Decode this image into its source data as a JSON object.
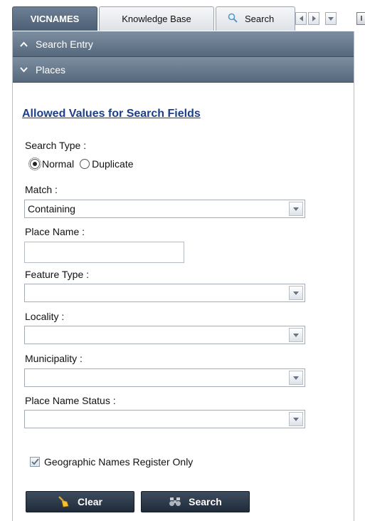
{
  "tabs": {
    "active": "VICNAMES",
    "knowledge_base": "Knowledge Base",
    "search": "Search",
    "pin": "I"
  },
  "accordion": {
    "search_entry": "Search Entry",
    "places": "Places"
  },
  "form": {
    "title": "Allowed Values for Search Fields",
    "search_type_label": "Search Type :",
    "radio_normal": "Normal",
    "radio_duplicate": "Duplicate",
    "selected_search_type": "Normal",
    "match_label": "Match :",
    "match_value": "Containing",
    "place_name_label": "Place Name :",
    "place_name_value": "",
    "feature_type_label": "Feature Type :",
    "feature_type_value": "",
    "locality_label": "Locality :",
    "locality_value": "",
    "municipality_label": "Municipality :",
    "municipality_value": "",
    "place_name_status_label": "Place Name Status :",
    "place_name_status_value": "",
    "geo_register_label": "Geographic Names Register Only",
    "geo_register_checked": true,
    "clear_label": "Clear",
    "search_label": "Search"
  },
  "colors": {
    "tab_active": "#56687c",
    "accordion_header": "#6a7b8f",
    "title_link": "#1c3f8c",
    "button_bg": "#2c3a4b"
  },
  "icons": {
    "search_tab": "magnifier-icon",
    "clear_button": "broom-icon",
    "search_button": "binoculars-icon"
  }
}
